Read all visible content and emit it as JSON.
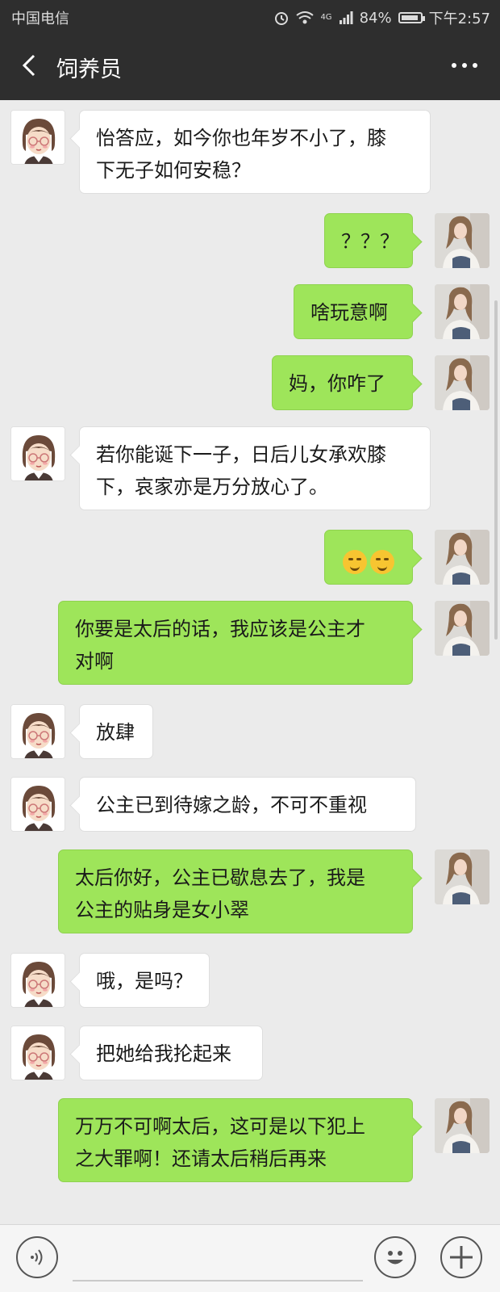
{
  "status_bar": {
    "carrier": "中国电信",
    "network": "4G",
    "battery": "84%",
    "time": "下午2:57"
  },
  "header": {
    "title": "饲养员"
  },
  "messages": [
    {
      "side": "left",
      "text": "怡答应，如今你也年岁不小了，膝\n下无子如何安稳？"
    },
    {
      "side": "right",
      "text": "？？？"
    },
    {
      "side": "right",
      "text": "啥玩意啊"
    },
    {
      "side": "right",
      "text": "妈，你咋了"
    },
    {
      "side": "left",
      "text": "若你能诞下一子，日后儿女承欢膝\n下，哀家亦是万分放心了。"
    },
    {
      "side": "right",
      "text": ""
    },
    {
      "side": "right",
      "text": "你要是太后的话，我应该是公主才\n对啊"
    },
    {
      "side": "left",
      "text": "放肆"
    },
    {
      "side": "left",
      "text": "公主已到待嫁之龄，不可不重视"
    },
    {
      "side": "right",
      "text": "太后你好，公主已歇息去了，我是\n公主的贴身是女小翠"
    },
    {
      "side": "left",
      "text": "哦，是吗？"
    },
    {
      "side": "left",
      "text": "把她给我抡起来"
    },
    {
      "side": "right",
      "text": "万万不可啊太后，这可是以下犯上\n之大罪啊！还请太后稍后再来"
    }
  ],
  "colors": {
    "accent": "#9ee55a",
    "header": "#2e2e2e",
    "background": "#ebebeb"
  },
  "icons": {
    "voice": "voice-icon",
    "emoji": "emoji-icon",
    "plus": "plus-icon"
  }
}
